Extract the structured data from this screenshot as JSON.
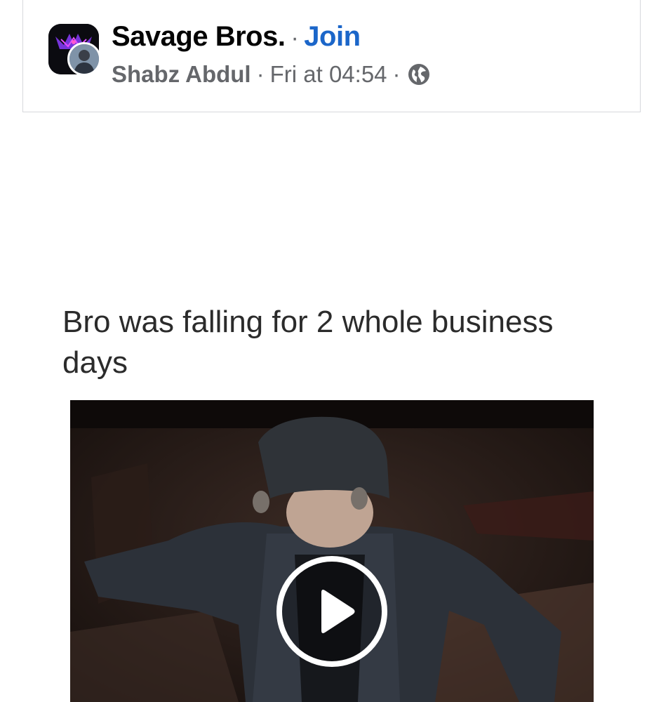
{
  "post": {
    "group_name": "Savage Bros.",
    "separator": "·",
    "join_label": "Join",
    "author_name": "Shabz Abdul",
    "timestamp": "Fri at 04:54",
    "audience_icon": "globe-icon"
  },
  "content": {
    "caption": "Bro was falling for 2 whole business days"
  },
  "media": {
    "type": "video",
    "play_icon": "play-icon"
  },
  "colors": {
    "link": "#1b66c9",
    "secondary_text": "#65676b",
    "primary_text": "#050505"
  }
}
